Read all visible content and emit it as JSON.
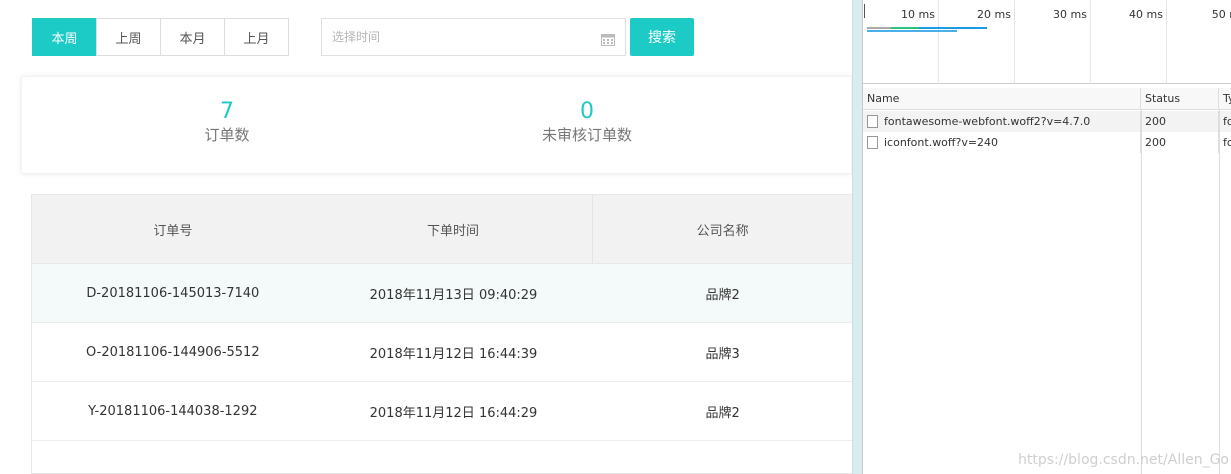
{
  "filters": {
    "segments": [
      "本周",
      "上周",
      "本月",
      "上月"
    ],
    "active_segment": "本周",
    "date_placeholder": "选择时间",
    "search_label": "搜索"
  },
  "stats": {
    "orders": {
      "value": "7",
      "label": "订单数"
    },
    "unreviewed": {
      "value": "0",
      "label": "未审核订单数"
    }
  },
  "table": {
    "headers": [
      "订单号",
      "下单时间",
      "公司名称"
    ],
    "rows": [
      {
        "order_no": "D-20181106-145013-7140",
        "time": "2018年11月13日 09:40:29",
        "company": "品牌2"
      },
      {
        "order_no": "O-20181106-144906-5512",
        "time": "2018年11月12日 16:44:39",
        "company": "品牌3"
      },
      {
        "order_no": "Y-20181106-144038-1292",
        "time": "2018年11月12日 16:44:29",
        "company": "品牌2"
      }
    ]
  },
  "devtools": {
    "timeline_ticks": [
      "10 ms",
      "20 ms",
      "30 ms",
      "40 ms",
      "50 m"
    ],
    "columns": {
      "name": "Name",
      "status": "Status",
      "type": "Ty"
    },
    "requests": [
      {
        "name": "fontawesome-webfont.woff2?v=4.7.0",
        "status": "200",
        "type": "fo"
      },
      {
        "name": "iconfont.woff?v=240",
        "status": "200",
        "type": "fo"
      }
    ],
    "waterfall_colors": {
      "queue": "#aaaaaa",
      "waiting": "#2ec27e",
      "download": "#1a9be6"
    }
  },
  "watermark": "https://blog.csdn.net/Allen_Go",
  "colors": {
    "accent": "#1ccbc6"
  }
}
